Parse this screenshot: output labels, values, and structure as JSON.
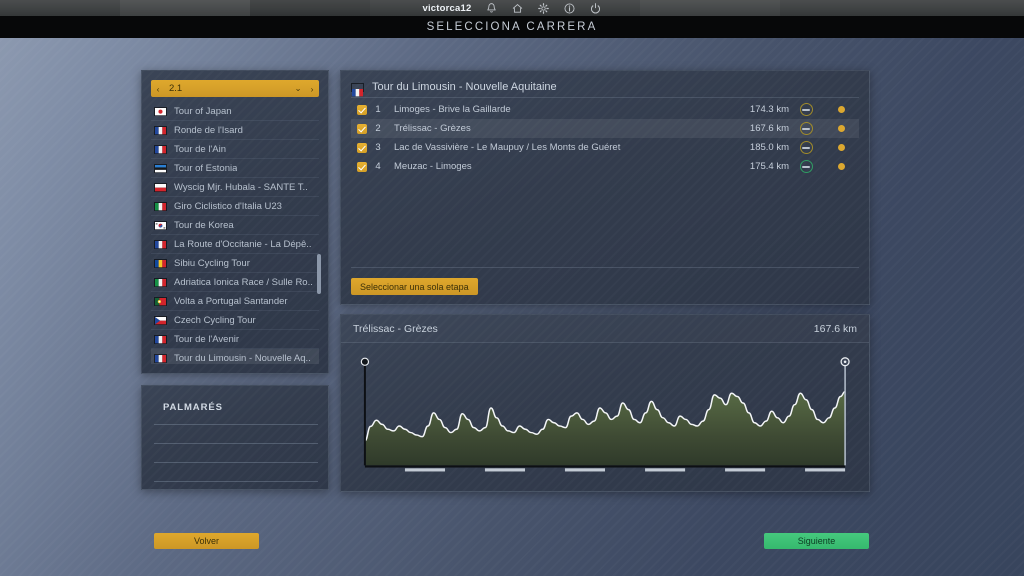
{
  "window": {
    "user": "victorca12",
    "sys_icons": [
      "bell-icon",
      "home-icon",
      "gear-icon",
      "info-icon",
      "power-icon"
    ],
    "title": "SELECCIONA CARRERA"
  },
  "sidebar": {
    "dropdown": {
      "value": "2.1",
      "prev": "‹",
      "next": "›",
      "caret": "⌄"
    },
    "races": [
      {
        "name": "Tour of Japan",
        "flag": "japan"
      },
      {
        "name": "Ronde de l'Isard",
        "flag": "france"
      },
      {
        "name": "Tour de l'Ain",
        "flag": "france"
      },
      {
        "name": "Tour of Estonia",
        "flag": "estonia"
      },
      {
        "name": "Wyscig Mjr. Hubala - SANTE T..",
        "flag": "poland"
      },
      {
        "name": "Giro Ciclistico d'Italia U23",
        "flag": "italy"
      },
      {
        "name": "Tour de Korea",
        "flag": "korea"
      },
      {
        "name": "La Route d'Occitanie - La Dépê..",
        "flag": "france"
      },
      {
        "name": "Sibiu Cycling Tour",
        "flag": "romania"
      },
      {
        "name": "Adriatica Ionica Race / Sulle Ro..",
        "flag": "italy"
      },
      {
        "name": "Volta a Portugal Santander",
        "flag": "portugal"
      },
      {
        "name": "Czech Cycling Tour",
        "flag": "czech"
      },
      {
        "name": "Tour de l'Avenir",
        "flag": "france"
      },
      {
        "name": "Tour du Limousin - Nouvelle Aq..",
        "flag": "france",
        "selected": true
      }
    ],
    "palmares": {
      "title": "PALMARÉS",
      "rows": 4
    }
  },
  "stages_panel": {
    "header": {
      "flag": "france",
      "title": "Tour du Limousin - Nouvelle Aquitaine"
    },
    "stages": [
      {
        "num": "1",
        "name": "Limoges - Brive la Gaillarde",
        "km": "174.3 km",
        "checked": true,
        "terrain": "flat-icon",
        "terrain_color": "#a08b2a",
        "dot_color": "#dca830"
      },
      {
        "num": "2",
        "name": "Trélissac - Grèzes",
        "km": "167.6 km",
        "checked": true,
        "terrain": "flat-icon",
        "terrain_color": "#a08b2a",
        "dot_color": "#dca830",
        "selected": true
      },
      {
        "num": "3",
        "name": "Lac de Vassivière - Le Maupuy / Les Monts de Guéret",
        "km": "185.0 km",
        "checked": true,
        "terrain": "flat-icon",
        "terrain_color": "#a08b2a",
        "dot_color": "#dca830"
      },
      {
        "num": "4",
        "name": "Meuzac - Limoges",
        "km": "175.4 km",
        "checked": true,
        "terrain": "flat-icon",
        "terrain_color": "#2f9c63",
        "dot_color": "#dca830"
      }
    ],
    "single_stage_button": "Seleccionar una sola etapa"
  },
  "profile_panel": {
    "name": "Trélissac - Grèzes",
    "distance": "167.6 km"
  },
  "footer": {
    "back": "Volver",
    "next": "Siguiente"
  },
  "colors": {
    "accent_gold": "#dca830",
    "accent_green": "#36b96e",
    "panel_bg": "#333c4d",
    "profile_fill": "#3f4a36"
  },
  "chart_data": {
    "type": "area",
    "title": "Trélissac - Grèzes",
    "xlabel": "",
    "ylabel": "",
    "distance_km": 167.6,
    "grid": false,
    "legend": null,
    "start_marker": {
      "label": "start",
      "x": 0
    },
    "finish_marker": {
      "label": "finish",
      "x": 167.6
    },
    "x": [
      0,
      2,
      4,
      6,
      8,
      10,
      12,
      14,
      16,
      18,
      20,
      22,
      24,
      26,
      28,
      30,
      32,
      34,
      36,
      38,
      40,
      42,
      44,
      46,
      48,
      50,
      52,
      54,
      56,
      58,
      60,
      62,
      64,
      66,
      68,
      70,
      72,
      74,
      76,
      78,
      80,
      82,
      84,
      86,
      88,
      90,
      92,
      94,
      96,
      98,
      100,
      102,
      104,
      106,
      108,
      110,
      112,
      114,
      116,
      118,
      120,
      122,
      124,
      126,
      128,
      130,
      132,
      134,
      136,
      138,
      140,
      142,
      144,
      146,
      148,
      150,
      152,
      154,
      156,
      158,
      160,
      162,
      164,
      166,
      167.6
    ],
    "elevation_m": [
      60,
      95,
      110,
      100,
      88,
      84,
      96,
      88,
      80,
      74,
      70,
      96,
      128,
      112,
      92,
      80,
      88,
      126,
      112,
      92,
      84,
      92,
      140,
      116,
      96,
      84,
      80,
      96,
      88,
      80,
      76,
      88,
      112,
      104,
      96,
      92,
      120,
      128,
      112,
      100,
      108,
      140,
      128,
      112,
      120,
      152,
      136,
      112,
      104,
      128,
      156,
      136,
      116,
      104,
      96,
      120,
      112,
      100,
      96,
      108,
      136,
      172,
      164,
      148,
      176,
      168,
      152,
      128,
      104,
      96,
      108,
      132,
      116,
      104,
      120,
      148,
      176,
      160,
      136,
      112,
      104,
      116,
      140,
      168,
      180
    ],
    "ylim": [
      0,
      260
    ]
  }
}
